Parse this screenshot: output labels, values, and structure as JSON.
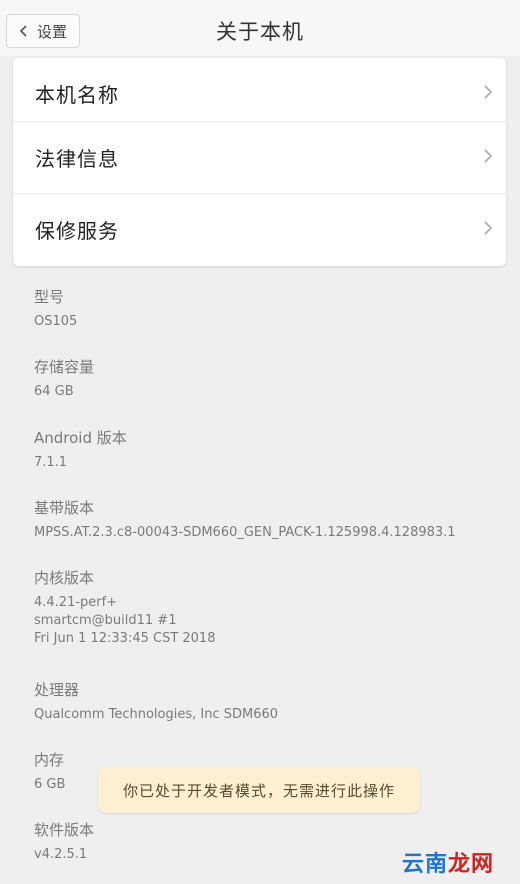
{
  "header": {
    "back_label": "设置",
    "title": "关于本机"
  },
  "menu": [
    {
      "label": "本机名称"
    },
    {
      "label": "法律信息"
    },
    {
      "label": "保修服务"
    }
  ],
  "info": {
    "model": {
      "label": "型号",
      "value": "OS105"
    },
    "storage": {
      "label": "存储容量",
      "value": "64 GB"
    },
    "android": {
      "label": "Android 版本",
      "value": "7.1.1"
    },
    "baseband": {
      "label": "基带版本",
      "value": "MPSS.AT.2.3.c8-00043-SDM660_GEN_PACK-1.125998.4.128983.1"
    },
    "kernel": {
      "label": "内核版本",
      "lines": [
        "4.4.21-perf+",
        "smartcm@build11 #1",
        "Fri Jun 1 12:33:45 CST 2018"
      ]
    },
    "processor": {
      "label": "处理器",
      "value": "Qualcomm Technologies, Inc SDM660"
    },
    "memory": {
      "label": "内存",
      "value": "6 GB"
    },
    "software": {
      "label": "软件版本",
      "value": "v4.2.5.1"
    }
  },
  "toast": {
    "message": "你已处于开发者模式，无需进行此操作"
  },
  "watermark": {
    "part1": "云南",
    "part2": "龙网"
  },
  "colors": {
    "background": "#efefef",
    "card": "#ffffff",
    "toast_bg": "#fdf0d2",
    "watermark_blue": "#1f74c7",
    "watermark_red": "#d02020"
  }
}
